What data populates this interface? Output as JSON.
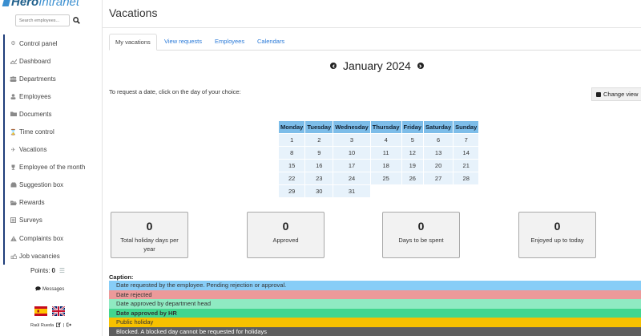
{
  "sidebar": {
    "logo": {
      "hero": "Hero",
      "intranet": "Intranet"
    },
    "search": {
      "placeholder": "Search employees..."
    },
    "items": [
      {
        "label": "Control panel",
        "icon": "gear-icon"
      },
      {
        "label": "Dashboard",
        "icon": "line-chart-icon"
      },
      {
        "label": "Departments",
        "icon": "users-icon"
      },
      {
        "label": "Employees",
        "icon": "user-icon"
      },
      {
        "label": "Documents",
        "icon": "folder-icon"
      },
      {
        "label": "Time control",
        "icon": "hourglass-icon"
      },
      {
        "label": "Vacations",
        "icon": "plane-icon"
      },
      {
        "label": "Employee of the month",
        "icon": "trophy-icon"
      },
      {
        "label": "Suggestion box",
        "icon": "inbox-icon"
      },
      {
        "label": "Rewards",
        "icon": "folder-open-icon"
      },
      {
        "label": "Surveys",
        "icon": "list-icon"
      },
      {
        "label": "Complaints box",
        "icon": "warning-icon"
      },
      {
        "label": "Job vacancies",
        "icon": "hand-icon"
      }
    ],
    "points_label": "Points:",
    "points_value": "0",
    "messages_label": "Messages",
    "user_name": "Raúl Rueda",
    "separator": "|"
  },
  "main": {
    "title": "Vacations",
    "tabs": [
      {
        "label": "My vacations",
        "active": true
      },
      {
        "label": "View requests",
        "active": false
      },
      {
        "label": "Employees",
        "active": false
      },
      {
        "label": "Calendars",
        "active": false
      }
    ],
    "month_label": "January 2024",
    "instruction": "To request a date, click on the day of your choice:",
    "change_view_label": "Change view",
    "calendar": {
      "headers": [
        "Monday",
        "Tuesday",
        "Wednesday",
        "Thursday",
        "Friday",
        "Saturday",
        "Sunday"
      ],
      "weeks": [
        [
          "1",
          "2",
          "3",
          "4",
          "5",
          "6",
          "7"
        ],
        [
          "8",
          "9",
          "10",
          "11",
          "12",
          "13",
          "14"
        ],
        [
          "15",
          "16",
          "17",
          "18",
          "19",
          "20",
          "21"
        ],
        [
          "22",
          "23",
          "24",
          "25",
          "26",
          "27",
          "28"
        ],
        [
          "29",
          "30",
          "31",
          "",
          "",
          "",
          ""
        ]
      ]
    },
    "stats": [
      {
        "value": "0",
        "label": "Total holiday days per year"
      },
      {
        "value": "0",
        "label": "Approved"
      },
      {
        "value": "0",
        "label": "Days to be spent"
      },
      {
        "value": "0",
        "label": "Enjoyed up to today"
      }
    ],
    "caption_title": "Caption:",
    "legend": [
      {
        "text": "Date requested by the employee. Pending rejection or approval.",
        "color": "#87cdf7",
        "bold": false
      },
      {
        "text": "Date rejected",
        "color": "#ec9a9a",
        "bold": false
      },
      {
        "text": "Date approved by department head",
        "color": "#8feac2",
        "bold": false
      },
      {
        "text": "Date approved by HR",
        "color": "#42d68f",
        "bold": true
      },
      {
        "text": "Public holiday",
        "color": "#f7c100",
        "bold": false
      },
      {
        "text": "Blocked. A blocked day cannot be requested for holidays",
        "color": "#5e5e5e",
        "bold": false,
        "text_color": "#ffffff"
      }
    ]
  }
}
